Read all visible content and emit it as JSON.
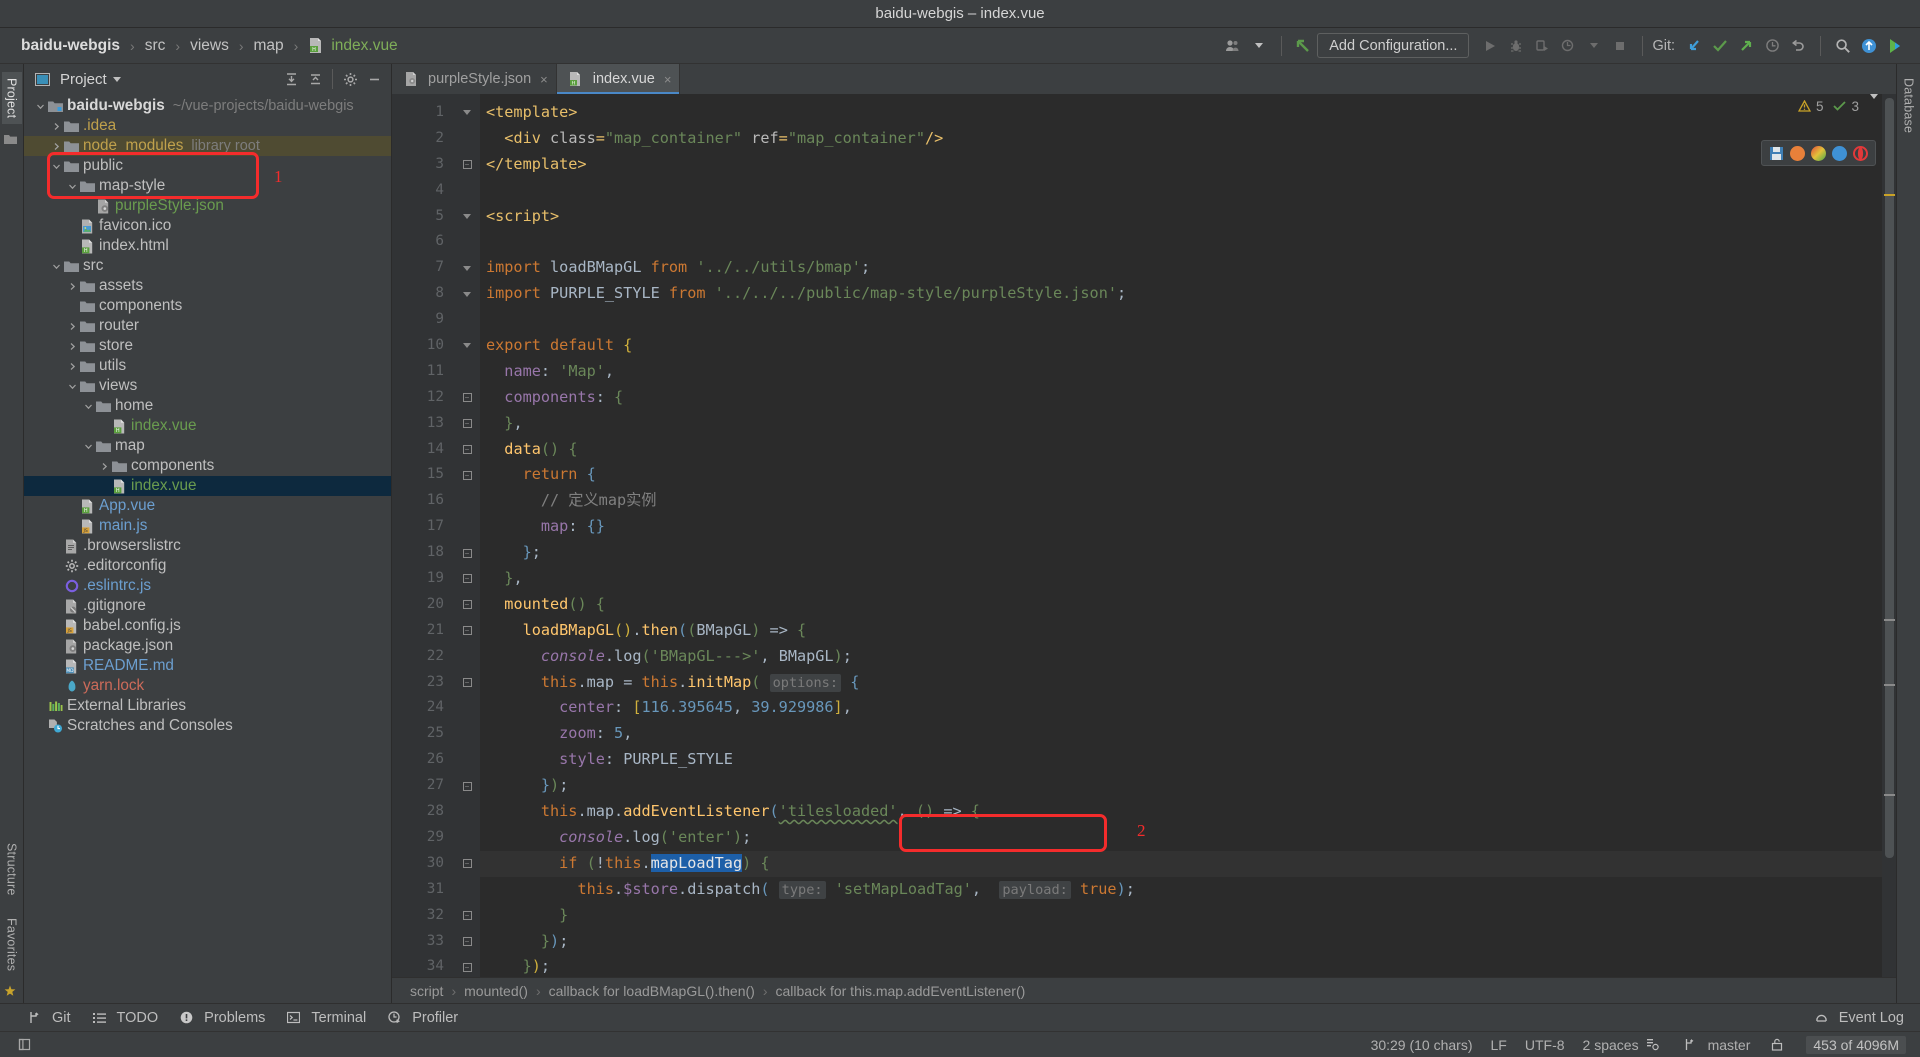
{
  "window": {
    "title": "baidu-webgis – index.vue"
  },
  "breadcrumb": {
    "items": [
      {
        "label": "baidu-webgis",
        "style": "bold"
      },
      {
        "label": "src",
        "style": "plain"
      },
      {
        "label": "views",
        "style": "plain"
      },
      {
        "label": "map",
        "style": "plain"
      },
      {
        "label": "index.vue",
        "style": "file"
      }
    ],
    "separator": "›"
  },
  "toolbar": {
    "add_configuration": "Add Configuration...",
    "git_label": "Git:",
    "icons": [
      "user-avatar-icon",
      "chevron-down-icon",
      "back-arrow-icon",
      "run-icon",
      "debug-icon",
      "run-with-coverage-icon",
      "profile-icon",
      "chevron-down-icon",
      "stop-icon",
      "git-update-icon",
      "git-commit-icon",
      "git-push-icon",
      "history-icon",
      "undo-icon",
      "search-icon",
      "upload-icon",
      "ide-icon"
    ]
  },
  "rail": {
    "left_top": "Project",
    "left_items": [
      "Structure",
      "Favorites"
    ],
    "right_items": [
      "Database"
    ]
  },
  "project_panel": {
    "title": "Project",
    "header_icons": [
      "expand-all-icon",
      "collapse-all-icon",
      "settings-gear-icon",
      "hide-panel-icon",
      "select-opened-file-icon"
    ],
    "tree": [
      {
        "depth": 0,
        "arrow": "down",
        "icon": "module-folder",
        "label": "baidu-webgis",
        "style": "bold",
        "sub": "~/vue-projects/baidu-webgis"
      },
      {
        "depth": 1,
        "arrow": "right",
        "icon": "folder",
        "label": ".idea",
        "style": "yellowish"
      },
      {
        "depth": 1,
        "arrow": "right",
        "icon": "folder",
        "label": "node_modules",
        "style": "yellowish",
        "sub": "library root",
        "highlight": true
      },
      {
        "depth": 1,
        "arrow": "down",
        "icon": "folder",
        "label": "public",
        "style": "plain"
      },
      {
        "depth": 2,
        "arrow": "down",
        "icon": "folder",
        "label": "map-style",
        "style": "plain"
      },
      {
        "depth": 3,
        "arrow": "none",
        "icon": "json-file",
        "label": "purpleStyle.json",
        "style": "green"
      },
      {
        "depth": 2,
        "arrow": "none",
        "icon": "image-file",
        "label": "favicon.ico",
        "style": "plain"
      },
      {
        "depth": 2,
        "arrow": "none",
        "icon": "html-file",
        "label": "index.html",
        "style": "plain"
      },
      {
        "depth": 1,
        "arrow": "down",
        "icon": "source-folder",
        "label": "src",
        "style": "plain"
      },
      {
        "depth": 2,
        "arrow": "right",
        "icon": "folder",
        "label": "assets",
        "style": "plain"
      },
      {
        "depth": 2,
        "arrow": "none",
        "icon": "folder",
        "label": "components",
        "style": "plain"
      },
      {
        "depth": 2,
        "arrow": "right",
        "icon": "folder",
        "label": "router",
        "style": "plain"
      },
      {
        "depth": 2,
        "arrow": "right",
        "icon": "folder",
        "label": "store",
        "style": "plain"
      },
      {
        "depth": 2,
        "arrow": "right",
        "icon": "folder",
        "label": "utils",
        "style": "plain"
      },
      {
        "depth": 2,
        "arrow": "down",
        "icon": "folder",
        "label": "views",
        "style": "plain"
      },
      {
        "depth": 3,
        "arrow": "down",
        "icon": "folder",
        "label": "home",
        "style": "plain"
      },
      {
        "depth": 4,
        "arrow": "none",
        "icon": "vue-file",
        "label": "index.vue",
        "style": "green"
      },
      {
        "depth": 3,
        "arrow": "down",
        "icon": "folder",
        "label": "map",
        "style": "plain"
      },
      {
        "depth": 4,
        "arrow": "right",
        "icon": "folder",
        "label": "components",
        "style": "plain"
      },
      {
        "depth": 4,
        "arrow": "none",
        "icon": "vue-file",
        "label": "index.vue",
        "style": "green",
        "selected": true
      },
      {
        "depth": 2,
        "arrow": "none",
        "icon": "vue-file",
        "label": "App.vue",
        "style": "blue"
      },
      {
        "depth": 2,
        "arrow": "none",
        "icon": "js-file",
        "label": "main.js",
        "style": "blue"
      },
      {
        "depth": 1,
        "arrow": "none",
        "icon": "text-file",
        "label": ".browserslistrc",
        "style": "plain"
      },
      {
        "depth": 1,
        "arrow": "none",
        "icon": "gear-file",
        "label": ".editorconfig",
        "style": "plain"
      },
      {
        "depth": 1,
        "arrow": "none",
        "icon": "eslint-file",
        "label": ".eslintrc.js",
        "style": "blue"
      },
      {
        "depth": 1,
        "arrow": "none",
        "icon": "gitignore-file",
        "label": ".gitignore",
        "style": "plain"
      },
      {
        "depth": 1,
        "arrow": "none",
        "icon": "js-file",
        "label": "babel.config.js",
        "style": "plain"
      },
      {
        "depth": 1,
        "arrow": "none",
        "icon": "json-file",
        "label": "package.json",
        "style": "plain"
      },
      {
        "depth": 1,
        "arrow": "none",
        "icon": "md-file",
        "label": "README.md",
        "style": "blue"
      },
      {
        "depth": 1,
        "arrow": "none",
        "icon": "yarn-file",
        "label": "yarn.lock",
        "style": "red"
      },
      {
        "depth": 0,
        "arrow": "none",
        "icon": "libraries-icon",
        "label": "External Libraries",
        "style": "plain"
      },
      {
        "depth": 0,
        "arrow": "none",
        "icon": "scratches-icon",
        "label": "Scratches and Consoles",
        "style": "plain"
      }
    ]
  },
  "tabs": [
    {
      "label": "purpleStyle.json",
      "icon": "json-file",
      "active": false,
      "close": "×"
    },
    {
      "label": "index.vue",
      "icon": "vue-file",
      "active": true,
      "close": "×"
    }
  ],
  "inspection": {
    "warning_count": "5",
    "ok_count": "3",
    "warning_icon": "warning-triangle-icon",
    "ok_icon": "check-icon",
    "chevron": "chevron-down-icon"
  },
  "code": {
    "first_line": 1,
    "lines": [
      "<template>",
      "  <div class=\"map_container\" ref=\"map_container\"/>",
      "</template>",
      "",
      "<script>",
      "",
      "import loadBMapGL from '../../utils/bmap';",
      "import PURPLE_STYLE from '../../../public/map-style/purpleStyle.json';",
      "",
      "export default {",
      "  name: 'Map',",
      "  components: {",
      "  },",
      "  data() {",
      "    return {",
      "      // 定义map实例",
      "      map: {}",
      "    };",
      "  },",
      "  mounted() {",
      "    loadBMapGL().then((BMapGL) => {",
      "      console.log('BMapGL--->', BMapGL);",
      "      this.map = this.initMap( options: {",
      "        center: [116.395645, 39.929986],",
      "        zoom: 5,",
      "        style: PURPLE_STYLE",
      "      });",
      "      this.map.addEventListener('tilesloaded', () => {",
      "        console.log('enter');",
      "        if (!this.mapLoadTag) {",
      "          this.$store.dispatch( type: 'setMapLoadTag',  payload: true);",
      "        }",
      "      });",
      "    });",
      "  },"
    ],
    "caret_line_number": 30,
    "selection_text": "mapLoadTag"
  },
  "annotations": [
    {
      "number": "1",
      "target": "map-style folder and purpleStyle.json file"
    },
    {
      "number": "2",
      "target": "style: PURPLE_STYLE option line"
    }
  ],
  "editor_breadcrumb": {
    "items": [
      "script",
      "mounted()",
      "callback for loadBMapGL().then()",
      "callback for this.map.addEventListener()"
    ],
    "separator": "›"
  },
  "bottom_tools": [
    {
      "label": "Git",
      "icon": "git-branch-icon"
    },
    {
      "label": "TODO",
      "icon": "todo-list-icon"
    },
    {
      "label": "Problems",
      "icon": "problems-icon"
    },
    {
      "label": "Terminal",
      "icon": "terminal-icon"
    },
    {
      "label": "Profiler",
      "icon": "profiler-icon"
    }
  ],
  "event_log": {
    "label": "Event Log",
    "icon": "event-log-icon"
  },
  "status": {
    "caret": "30:29 (10 chars)",
    "line_separator": "LF",
    "encoding": "UTF-8",
    "indent": "2 spaces",
    "branch": "master",
    "memory": "453 of 4096M",
    "lock_icon": "lock-icon",
    "branch_icon": "git-branch-icon",
    "indent_icon": "indent-config-icon"
  },
  "colors": {
    "accent_blue": "#4a88c7",
    "annotation_red": "#f42c2c",
    "selection_blue": "#1d5fa8",
    "panel_bg": "#3c3f41",
    "editor_bg": "#2b2b2b",
    "gutter_bg": "#313335",
    "tree_selected": "#0d293e",
    "string_green": "#6a8759",
    "keyword_orange": "#cc7832"
  }
}
